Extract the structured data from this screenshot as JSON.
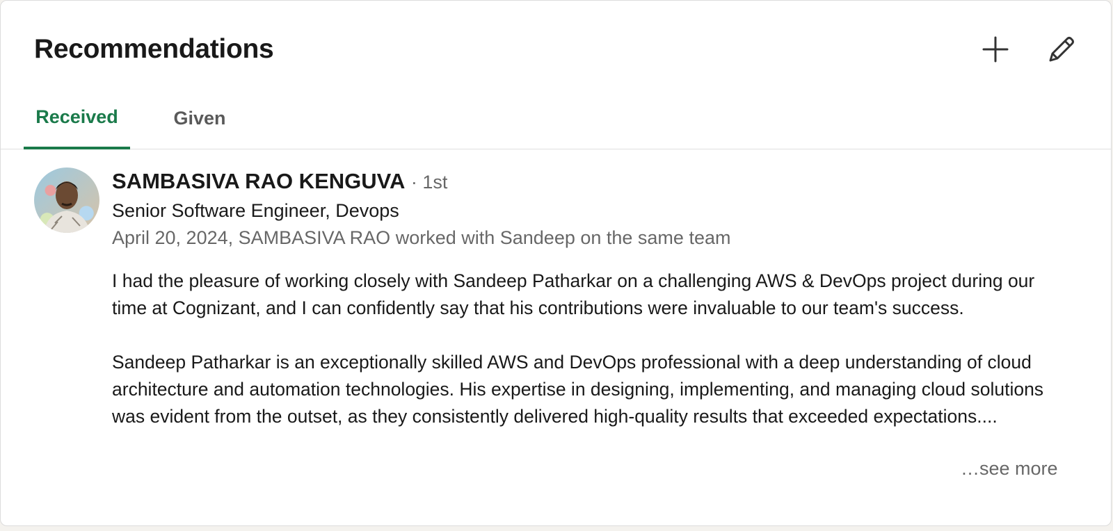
{
  "section": {
    "title": "Recommendations",
    "add_icon": "plus-icon",
    "edit_icon": "pencil-icon"
  },
  "tabs": [
    {
      "label": "Received",
      "active": true
    },
    {
      "label": "Given",
      "active": false
    }
  ],
  "colors": {
    "accent": "#1a7a4a",
    "text_primary": "#191919",
    "text_secondary": "#666666"
  },
  "recommendation": {
    "name": "SAMBASIVA RAO KENGUVA",
    "degree": "· 1st",
    "headline": "Senior Software Engineer, Devops",
    "meta": "April 20, 2024, SAMBASIVA RAO worked with Sandeep on the same team",
    "paragraphs": [
      "I had the pleasure of working closely with Sandeep Patharkar on a challenging AWS & DevOps project during our time at Cognizant, and I can confidently say that his contributions were invaluable to our team's success.",
      "Sandeep Patharkar is an exceptionally skilled AWS and DevOps professional with a deep understanding of cloud architecture and automation technologies. His expertise in designing, implementing, and managing cloud solutions was evident from the outset, as they consistently delivered high-quality results that exceeded expectations...."
    ],
    "see_more": "…see more"
  }
}
